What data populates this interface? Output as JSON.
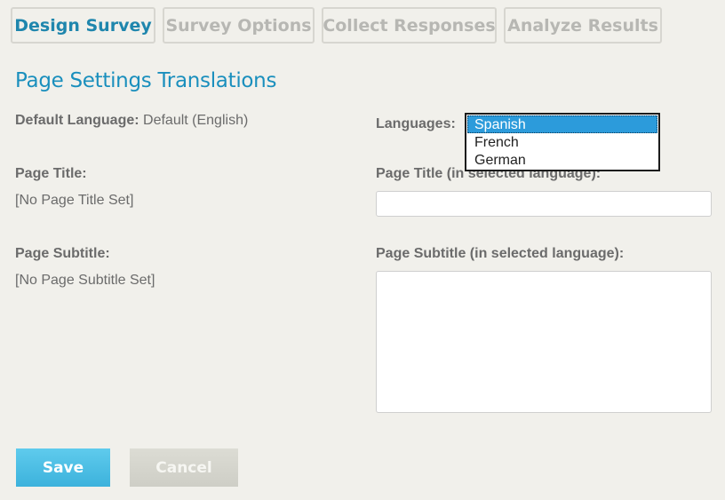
{
  "tabs": [
    {
      "label": "Design Survey",
      "active": true
    },
    {
      "label": "Survey Options",
      "active": false
    },
    {
      "label": "Collect Responses",
      "active": false
    },
    {
      "label": "Analyze Results",
      "active": false
    }
  ],
  "page": {
    "heading": "Page Settings Translations"
  },
  "default_language": {
    "label": "Default Language:",
    "value": "Default (English)"
  },
  "languages": {
    "label": "Languages:",
    "options": [
      "Spanish",
      "French",
      "German"
    ],
    "selected": "Spanish"
  },
  "page_title": {
    "label": "Page Title:",
    "value": "[No Page Title Set]",
    "translated_label": "Page Title (in selected language):",
    "translated_value": ""
  },
  "page_subtitle": {
    "label": "Page Subtitle:",
    "value": "[No Page Subtitle Set]",
    "translated_label": "Page Subtitle (in selected language):",
    "translated_value": ""
  },
  "actions": {
    "save_label": "Save",
    "cancel_label": "Cancel"
  },
  "colors": {
    "background": "#f1f0eb",
    "accent": "#1a8fbd",
    "save_button": "#3cb2dc",
    "cancel_button": "#cecec6",
    "selection": "#2c9bdb"
  }
}
